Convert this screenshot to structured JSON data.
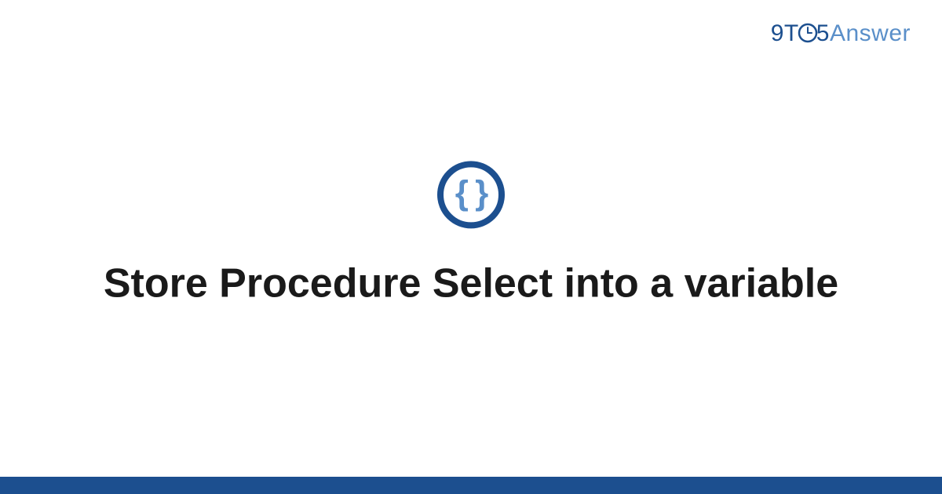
{
  "logo": {
    "part1": "9T",
    "part2": "5",
    "part3": "Answer"
  },
  "icon": {
    "braces": "{ }"
  },
  "title": "Store Procedure Select into a variable",
  "colors": {
    "primary": "#1c4f8f",
    "secondary": "#5a8fc9"
  }
}
